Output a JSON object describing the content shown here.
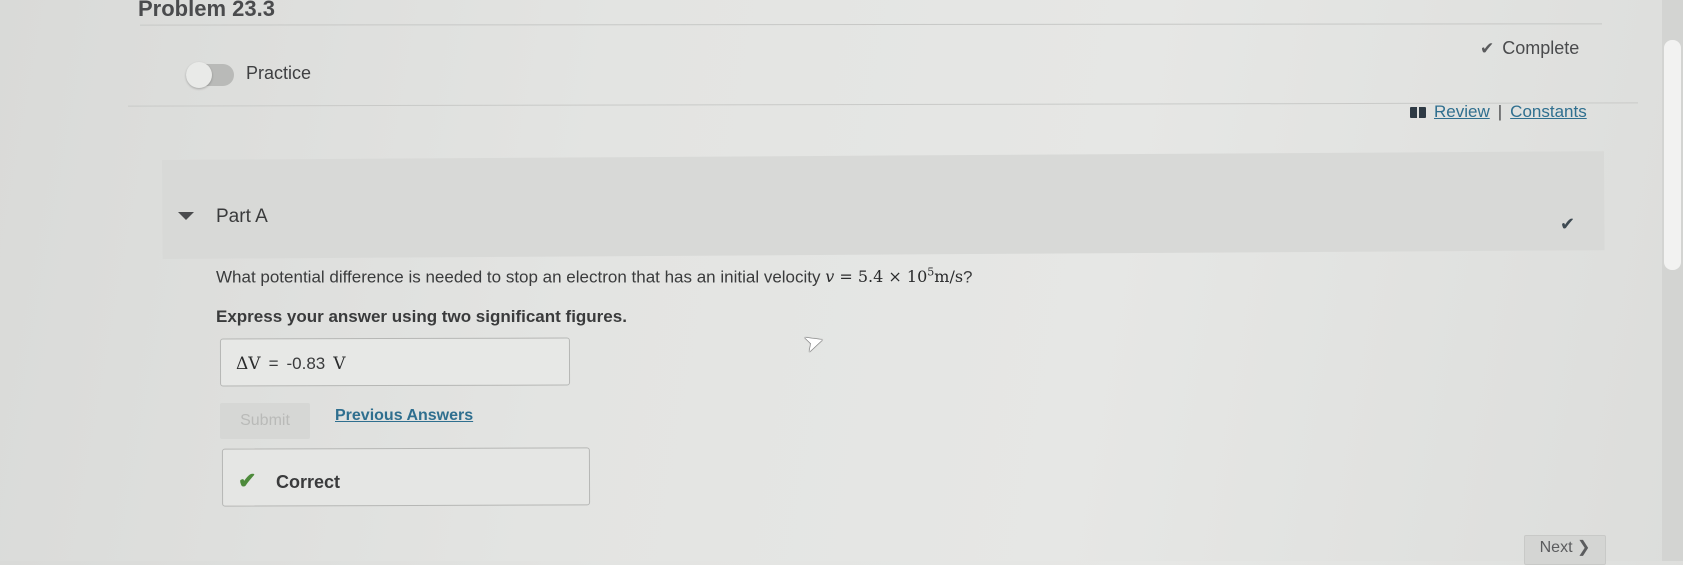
{
  "problem": {
    "title": "Problem 23.3"
  },
  "header": {
    "practice_label": "Practice",
    "complete_label": "Complete",
    "review_link": "Review",
    "separator": "|",
    "constants_link": "Constants"
  },
  "part": {
    "label": "Part A",
    "question_text": "What potential difference is needed to stop an electron that has an initial velocity",
    "velocity_var": "v",
    "velocity_eq": " = 5.4 × 10",
    "velocity_exp": "5",
    "velocity_unit": "m/s",
    "question_end": "?",
    "instruction": "Express your answer using two significant figures."
  },
  "answer": {
    "variable": "ΔV",
    "equals": "=",
    "value": "-0.83",
    "unit": "V"
  },
  "actions": {
    "submit_label": "Submit",
    "previous_answers_label": "Previous Answers"
  },
  "feedback": {
    "correct_label": "Correct"
  },
  "navigation": {
    "next_label": "Next"
  },
  "icons": {
    "complete": "check-icon",
    "review": "book-icon",
    "part_collapse": "caret-down-icon",
    "part_status": "check-icon",
    "correct": "check-icon",
    "next": "chevron-right-icon"
  },
  "colors": {
    "link": "#2f6f8f",
    "correct": "#4d8a3b",
    "part_header_bg": "#d8d9d7"
  }
}
